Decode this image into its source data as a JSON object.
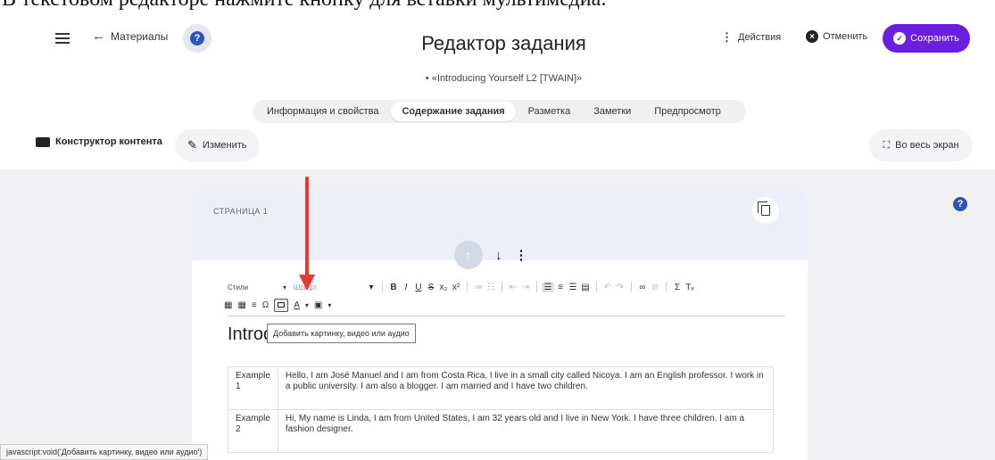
{
  "caption": "В текстовом редакторе нажмите кнопку для вставки мультимедиа:",
  "header": {
    "back_label": "Материалы",
    "title": "Редактор задания",
    "subtitle": "• «Introducing Yourself L2 [TWAIN]»",
    "actions_label": "Действия",
    "cancel_label": "Отменить",
    "save_label": "Сохранить"
  },
  "tabs": [
    {
      "label": "Информация и свойства",
      "active": false
    },
    {
      "label": "Содержание задания",
      "active": true
    },
    {
      "label": "Разметка",
      "active": false
    },
    {
      "label": "Заметки",
      "active": false
    },
    {
      "label": "Предпросмотр",
      "active": false
    }
  ],
  "subbar": {
    "constructor_label": "Конструктор контента",
    "edit_label": "Изменить",
    "fullscreen_label": "Во весь экран"
  },
  "card": {
    "page_label": "СТРАНИЦА 1"
  },
  "editor": {
    "styles_label": "Стили",
    "font_label": "Шрифт",
    "heading_text": "Introduce Yo",
    "tooltip": "Добавить картинку, видео или аудио"
  },
  "examples": [
    {
      "label": "Example 1",
      "text": "Hello, I am José Manuel and I am from Costa Rica, I live in a small city called Nicoya. I am an English professor. I work in a public university. I am also a blogger. I am married and I have two children."
    },
    {
      "label": "Example 2",
      "text": "Hi, My name is Linda, I am from United States, I am 32 years old and I live in New York. I have three children. I am a fashion designer."
    }
  ],
  "status_bar": "javascript:void('Добавить картинку, видео или аудио')",
  "colors": {
    "save_button": "#6a1fe0",
    "arrow": "#e53935",
    "help": "#2f54b8"
  }
}
